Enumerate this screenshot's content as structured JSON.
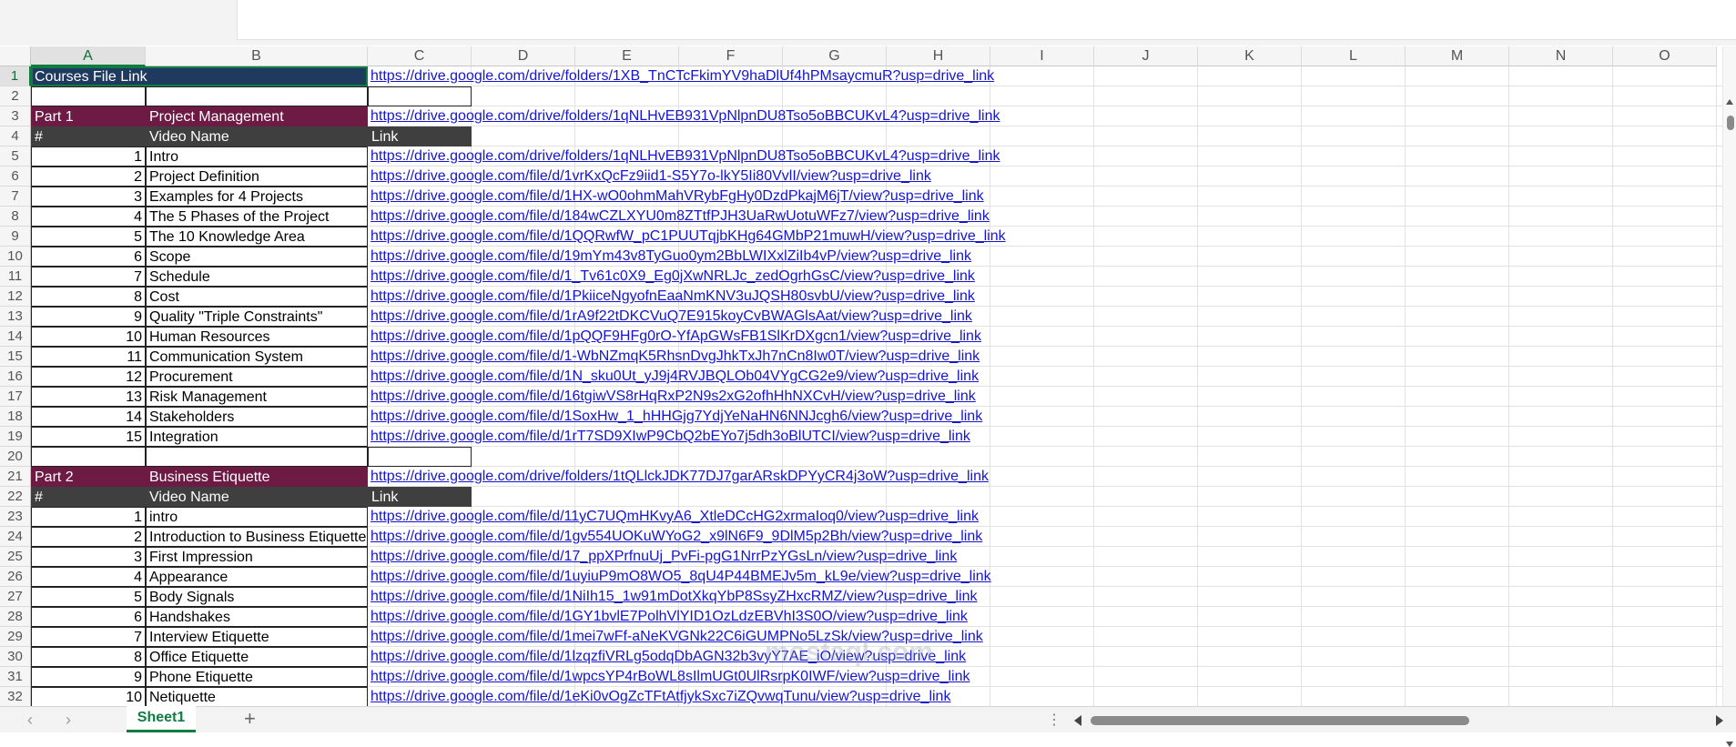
{
  "columns": [
    "A",
    "B",
    "C",
    "D",
    "E",
    "F",
    "G",
    "H",
    "I",
    "J",
    "K",
    "L",
    "M",
    "N",
    "O"
  ],
  "rows": [
    "1",
    "2",
    "3",
    "4",
    "5",
    "6",
    "7",
    "8",
    "9",
    "10",
    "11",
    "12",
    "13",
    "14",
    "15",
    "16",
    "17",
    "18",
    "19",
    "20",
    "21",
    "22",
    "23",
    "24",
    "25",
    "26",
    "27",
    "28",
    "29",
    "30",
    "31",
    "32"
  ],
  "r1": {
    "a": "Courses File Link",
    "link": "https://drive.google.com/drive/folders/1XB_TnCTcFkimYV9haDlUf4hPMsaycmuR?usp=drive_link"
  },
  "r3": {
    "a": "Part 1",
    "b": "Project Management",
    "link": "https://drive.google.com/drive/folders/1qNLHvEB931VpNlpnDU8Tso5oBBCUKvL4?usp=drive_link"
  },
  "r4": {
    "a": "#",
    "b": "Video Name",
    "c": "Link"
  },
  "part1": [
    {
      "n": "1",
      "name": "Intro",
      "link": "https://drive.google.com/drive/folders/1qNLHvEB931VpNlpnDU8Tso5oBBCUKvL4?usp=drive_link"
    },
    {
      "n": "2",
      "name": "Project Definition",
      "link": "https://drive.google.com/file/d/1vrKxQcFz9iid1-S5Y7o-lkY5Ii80VvlI/view?usp=drive_link"
    },
    {
      "n": "3",
      "name": "Examples for 4 Projects",
      "link": "https://drive.google.com/file/d/1HX-wO0ohmMahVRybFgHy0DzdPkajM6jT/view?usp=drive_link"
    },
    {
      "n": "4",
      "name": "The 5 Phases of the Project",
      "link": "https://drive.google.com/file/d/184wCZLXYU0m8ZTtfPJH3UaRwUotuWFz7/view?usp=drive_link"
    },
    {
      "n": "5",
      "name": "The 10 Knowledge Area",
      "link": "https://drive.google.com/file/d/1QQRwfW_pC1PUUTqjbKHg64GMbP21muwH/view?usp=drive_link"
    },
    {
      "n": "6",
      "name": "Scope",
      "link": "https://drive.google.com/file/d/19mYm43v8TyGuo0ym2BbLWIXxlZiIb4vP/view?usp=drive_link"
    },
    {
      "n": "7",
      "name": "Schedule",
      "link": "https://drive.google.com/file/d/1_Tv61c0X9_Eg0jXwNRLJc_zedOgrhGsC/view?usp=drive_link"
    },
    {
      "n": "8",
      "name": "Cost",
      "link": "https://drive.google.com/file/d/1PkiiceNgyofnEaaNmKNV3uJQSH80svbU/view?usp=drive_link"
    },
    {
      "n": "9",
      "name": "Quality \"Triple Constraints\"",
      "link": "https://drive.google.com/file/d/1rA9f22tDKCVuQ7E915koyCvBWAGlsAat/view?usp=drive_link"
    },
    {
      "n": "10",
      "name": "Human Resources",
      "link": "https://drive.google.com/file/d/1pQQF9HFg0rO-YfApGWsFB1SlKrDXgcn1/view?usp=drive_link"
    },
    {
      "n": "11",
      "name": "Communication System",
      "link": "https://drive.google.com/file/d/1-WbNZmqK5RhsnDvgJhkTxJh7nCn8Iw0T/view?usp=drive_link"
    },
    {
      "n": "12",
      "name": "Procurement",
      "link": "https://drive.google.com/file/d/1N_sku0Ut_yJ9j4RVJBQLOb04VYgCG2e9/view?usp=drive_link"
    },
    {
      "n": "13",
      "name": "Risk Management",
      "link": "https://drive.google.com/file/d/16tgiwVS8rHqRxP2N9s2xG2ofhHhNXCvH/view?usp=drive_link"
    },
    {
      "n": "14",
      "name": "Stakeholders",
      "link": "https://drive.google.com/file/d/1SoxHw_1_hHHGjg7YdjYeNaHN6NNJcgh6/view?usp=drive_link"
    },
    {
      "n": "15",
      "name": "Integration",
      "link": "https://drive.google.com/file/d/1rT7SD9XIwP9CbQ2bEYo7j5dh3oBlUTCI/view?usp=drive_link"
    }
  ],
  "r21": {
    "a": "Part 2",
    "b": "Business Etiquette",
    "link": "https://drive.google.com/drive/folders/1tQLlckJDK77DJ7garARskDPYyCR4j3oW?usp=drive_link"
  },
  "r22": {
    "a": "#",
    "b": "Video Name",
    "c": "Link"
  },
  "part2": [
    {
      "n": "1",
      "name": "intro",
      "link": "https://drive.google.com/file/d/11yC7UQmHKvyA6_XtleDCcHG2xrmaIoq0/view?usp=drive_link"
    },
    {
      "n": "2",
      "name": "Introduction to Business Etiquette",
      "link": "https://drive.google.com/file/d/1gv554UOKuWYoG2_x9lN6F9_9DlM5p2Bh/view?usp=drive_link"
    },
    {
      "n": "3",
      "name": "First Impression",
      "link": "https://drive.google.com/file/d/17_ppXPrfnuUj_PvFi-pgG1NrrPzYGsLn/view?usp=drive_link"
    },
    {
      "n": "4",
      "name": "Appearance",
      "link": "https://drive.google.com/file/d/1uyiuP9mO8WO5_8qU4P44BMEJv5m_kL9e/view?usp=drive_link"
    },
    {
      "n": "5",
      "name": "Body Signals",
      "link": "https://drive.google.com/file/d/1NiIh15_1w91mDotXkqYbP8SsyZHxcRMZ/view?usp=drive_link"
    },
    {
      "n": "6",
      "name": "Handshakes",
      "link": "https://drive.google.com/file/d/1GY1bvlE7PolhVlYID1OzLdzEBVhI3S0O/view?usp=drive_link"
    },
    {
      "n": "7",
      "name": "Interview Etiquette",
      "link": "https://drive.google.com/file/d/1mei7wFf-aNeKVGNk22C6iGUMPNo5LzSk/view?usp=drive_link"
    },
    {
      "n": "8",
      "name": "Office Etiquette",
      "link": "https://drive.google.com/file/d/1lzqzfiVRLg5odqDbAGN32b3vyY7AE_iO/view?usp=drive_link"
    },
    {
      "n": "9",
      "name": "Phone Etiquette",
      "link": "https://drive.google.com/file/d/1wpcsYP4rBoWL8sIlmUGt0UlRsrpK0IWF/view?usp=drive_link"
    },
    {
      "n": "10",
      "name": "Netiquette",
      "link": "https://drive.google.com/file/d/1eKi0vOgZcTFtAtfjykSxc7iZQvwqTunu/view?usp=drive_link"
    }
  ],
  "sheet_tab": "Sheet1",
  "add_sheet": "+",
  "nav_prev": "‹",
  "nav_next": "›",
  "more_dots": "⋮",
  "watermark": "mostaql.com",
  "colors": {
    "accent": "#107c41",
    "maroon": "#6d1a44",
    "dark_header": "#3f3f3f",
    "link": "#1515d0",
    "selected_cell": "#1e3a5f"
  }
}
